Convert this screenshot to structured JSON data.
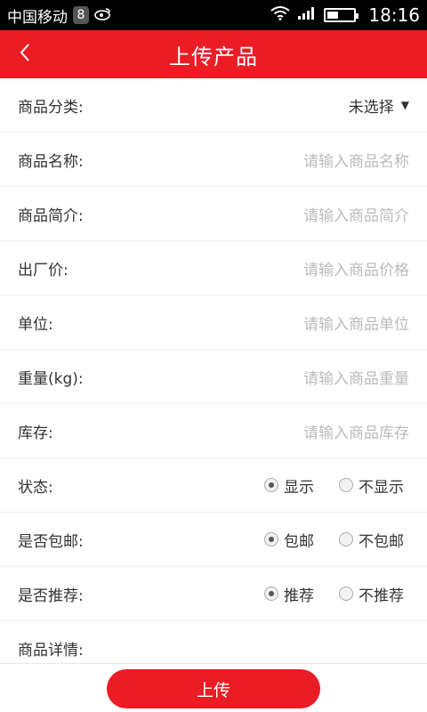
{
  "status_bar": {
    "carrier": "中国移动",
    "badge": "8",
    "time": "18:16",
    "battery_level": 0.4
  },
  "header": {
    "title": "上传产品",
    "back_icon": "chevron-left-icon"
  },
  "form": {
    "category": {
      "label": "商品分类:",
      "value": "未选择",
      "arrow": "▼"
    },
    "name": {
      "label": "商品名称:",
      "placeholder": "请输入商品名称"
    },
    "intro": {
      "label": "商品简介:",
      "placeholder": "请输入商品简介"
    },
    "price": {
      "label": "出厂价:",
      "placeholder": "请输入商品价格"
    },
    "unit": {
      "label": "单位:",
      "placeholder": "请输入商品单位"
    },
    "weight": {
      "label": "重量(kg):",
      "placeholder": "请输入商品重量"
    },
    "stock": {
      "label": "库存:",
      "placeholder": "请输入商品库存"
    },
    "status": {
      "label": "状态:",
      "options": [
        "显示",
        "不显示"
      ],
      "selected": 0
    },
    "shipping": {
      "label": "是否包邮:",
      "options": [
        "包邮",
        "不包邮"
      ],
      "selected": 0
    },
    "recommend": {
      "label": "是否推荐:",
      "options": [
        "推荐",
        "不推荐"
      ],
      "selected": 0
    },
    "detail": {
      "label": "商品详情:"
    }
  },
  "footer": {
    "upload_label": "上传"
  },
  "colors": {
    "accent": "#ec1c24",
    "placeholder": "#bbbbbb",
    "text": "#333333"
  }
}
